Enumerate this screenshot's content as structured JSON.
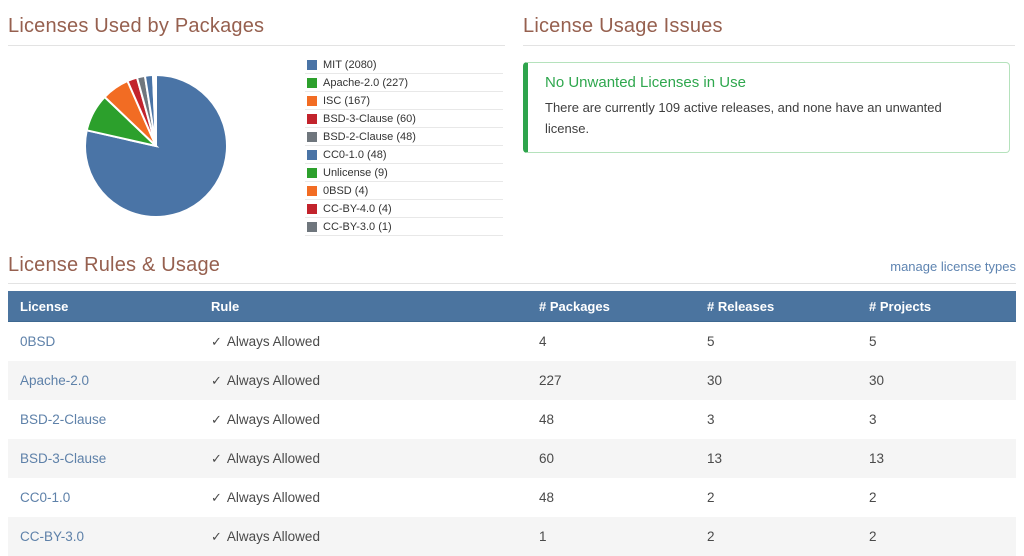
{
  "pie_section": {
    "title": "Licenses Used by Packages"
  },
  "chart_data": {
    "type": "pie",
    "title": "Licenses Used by Packages",
    "labels": [
      "MIT",
      "Apache-2.0",
      "ISC",
      "BSD-3-Clause",
      "BSD-2-Clause",
      "CC0-1.0",
      "Unlicense",
      "0BSD",
      "CC-BY-4.0",
      "CC-BY-3.0"
    ],
    "values": [
      2080,
      227,
      167,
      60,
      48,
      48,
      9,
      4,
      4,
      1
    ],
    "legend_labels": [
      "MIT (2080)",
      "Apache-2.0 (227)",
      "ISC (167)",
      "BSD-3-Clause (60)",
      "BSD-2-Clause (48)",
      "CC0-1.0 (48)",
      "Unlicense (9)",
      "0BSD (4)",
      "CC-BY-4.0 (4)",
      "CC-BY-3.0 (1)"
    ],
    "palette": [
      "#4a74a6",
      "#2ca02c",
      "#f26c23",
      "#c2232c",
      "#6f767d"
    ],
    "start_angle_deg": -90,
    "direction": "clockwise",
    "legend_position": "right",
    "slice_stroke": "#ffffff"
  },
  "issues_section": {
    "title": "License Usage Issues",
    "alert": {
      "title": "No Unwanted Licenses in Use",
      "body": "There are currently 109 active releases, and none have an unwanted license."
    }
  },
  "rules_section": {
    "title": "License Rules & Usage",
    "manage_link_label": "manage license types",
    "table": {
      "columns": [
        "License",
        "Rule",
        "# Packages",
        "# Releases",
        "# Projects"
      ],
      "column_keys": [
        "license",
        "rule",
        "packages",
        "releases",
        "projects"
      ],
      "check_icon": "✓",
      "rows": [
        {
          "license": "0BSD",
          "rule": "Always Allowed",
          "packages": "4",
          "releases": "5",
          "projects": "5"
        },
        {
          "license": "Apache-2.0",
          "rule": "Always Allowed",
          "packages": "227",
          "releases": "30",
          "projects": "30"
        },
        {
          "license": "BSD-2-Clause",
          "rule": "Always Allowed",
          "packages": "48",
          "releases": "3",
          "projects": "3"
        },
        {
          "license": "BSD-3-Clause",
          "rule": "Always Allowed",
          "packages": "60",
          "releases": "13",
          "projects": "13"
        },
        {
          "license": "CC0-1.0",
          "rule": "Always Allowed",
          "packages": "48",
          "releases": "2",
          "projects": "2"
        },
        {
          "license": "CC-BY-3.0",
          "rule": "Always Allowed",
          "packages": "1",
          "releases": "2",
          "projects": "2"
        }
      ]
    }
  },
  "colors": {
    "heading": "#96604f",
    "heading_rule": "#e3e3e3",
    "table_header_bg": "#4b749f",
    "table_header_text": "#ffffff",
    "row_alt_bg": "#f5f5f5",
    "cell_text": "#4a4a4a",
    "license_link": "#5e81a9",
    "manage_link": "#5e84b1",
    "rule_status_green": "#3fa27d",
    "alert_border": "#b5e2bc",
    "alert_accent": "#2ea44c",
    "alert_title": "#2fa74e",
    "alert_body_text": "#3e3e3e"
  }
}
